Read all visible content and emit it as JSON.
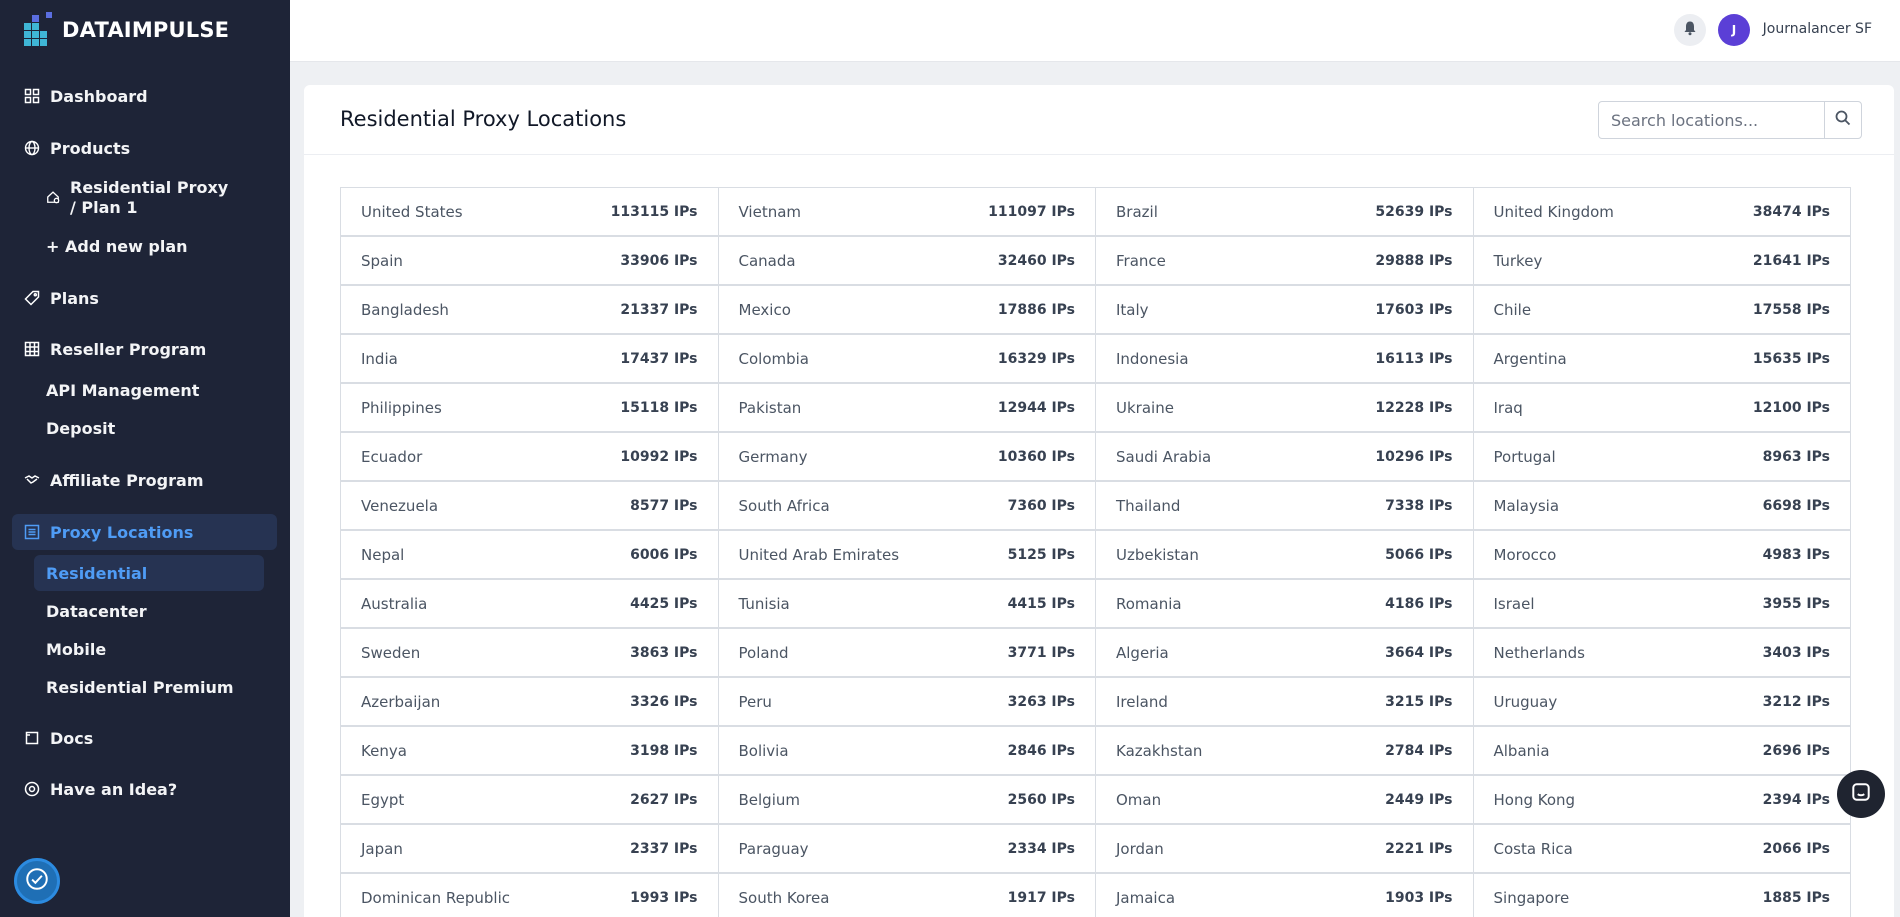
{
  "brand": {
    "name": "DATAIMPULSE",
    "mark_color": "#3fb6d6"
  },
  "sidebar": {
    "items": [
      {
        "label": "Dashboard",
        "icon": "dashboard-icon"
      },
      {
        "label": "Products",
        "icon": "globe-icon"
      },
      {
        "label": "Residential Proxy / Plan 1",
        "icon": "house-icon"
      },
      {
        "label": "+ Add new plan"
      },
      {
        "label": "Plans",
        "icon": "tag-icon"
      },
      {
        "label": "Reseller Program",
        "icon": "grid-icon"
      },
      {
        "label": "API Management"
      },
      {
        "label": "Deposit"
      },
      {
        "label": "Affiliate Program",
        "icon": "handshake-icon"
      },
      {
        "label": "Proxy Locations",
        "icon": "list-icon"
      },
      {
        "label": "Residential"
      },
      {
        "label": "Datacenter"
      },
      {
        "label": "Mobile"
      },
      {
        "label": "Residential Premium"
      },
      {
        "label": "Docs",
        "icon": "docs-icon"
      },
      {
        "label": "Have an Idea?",
        "icon": "idea-icon"
      }
    ]
  },
  "header": {
    "avatar_initial": "J",
    "username": "Journalancer SF"
  },
  "main": {
    "title": "Residential Proxy Locations",
    "search_placeholder": "Search locations...",
    "locations": [
      [
        "United States",
        "113115 IPs"
      ],
      [
        "Vietnam",
        "111097 IPs"
      ],
      [
        "Brazil",
        "52639 IPs"
      ],
      [
        "United Kingdom",
        "38474 IPs"
      ],
      [
        "Spain",
        "33906 IPs"
      ],
      [
        "Canada",
        "32460 IPs"
      ],
      [
        "France",
        "29888 IPs"
      ],
      [
        "Turkey",
        "21641 IPs"
      ],
      [
        "Bangladesh",
        "21337 IPs"
      ],
      [
        "Mexico",
        "17886 IPs"
      ],
      [
        "Italy",
        "17603 IPs"
      ],
      [
        "Chile",
        "17558 IPs"
      ],
      [
        "India",
        "17437 IPs"
      ],
      [
        "Colombia",
        "16329 IPs"
      ],
      [
        "Indonesia",
        "16113 IPs"
      ],
      [
        "Argentina",
        "15635 IPs"
      ],
      [
        "Philippines",
        "15118 IPs"
      ],
      [
        "Pakistan",
        "12944 IPs"
      ],
      [
        "Ukraine",
        "12228 IPs"
      ],
      [
        "Iraq",
        "12100 IPs"
      ],
      [
        "Ecuador",
        "10992 IPs"
      ],
      [
        "Germany",
        "10360 IPs"
      ],
      [
        "Saudi Arabia",
        "10296 IPs"
      ],
      [
        "Portugal",
        "8963 IPs"
      ],
      [
        "Venezuela",
        "8577 IPs"
      ],
      [
        "South Africa",
        "7360 IPs"
      ],
      [
        "Thailand",
        "7338 IPs"
      ],
      [
        "Malaysia",
        "6698 IPs"
      ],
      [
        "Nepal",
        "6006 IPs"
      ],
      [
        "United Arab Emirates",
        "5125 IPs"
      ],
      [
        "Uzbekistan",
        "5066 IPs"
      ],
      [
        "Morocco",
        "4983 IPs"
      ],
      [
        "Australia",
        "4425 IPs"
      ],
      [
        "Tunisia",
        "4415 IPs"
      ],
      [
        "Romania",
        "4186 IPs"
      ],
      [
        "Israel",
        "3955 IPs"
      ],
      [
        "Sweden",
        "3863 IPs"
      ],
      [
        "Poland",
        "3771 IPs"
      ],
      [
        "Algeria",
        "3664 IPs"
      ],
      [
        "Netherlands",
        "3403 IPs"
      ],
      [
        "Azerbaijan",
        "3326 IPs"
      ],
      [
        "Peru",
        "3263 IPs"
      ],
      [
        "Ireland",
        "3215 IPs"
      ],
      [
        "Uruguay",
        "3212 IPs"
      ],
      [
        "Kenya",
        "3198 IPs"
      ],
      [
        "Bolivia",
        "2846 IPs"
      ],
      [
        "Kazakhstan",
        "2784 IPs"
      ],
      [
        "Albania",
        "2696 IPs"
      ],
      [
        "Egypt",
        "2627 IPs"
      ],
      [
        "Belgium",
        "2560 IPs"
      ],
      [
        "Oman",
        "2449 IPs"
      ],
      [
        "Hong Kong",
        "2394 IPs"
      ],
      [
        "Japan",
        "2337 IPs"
      ],
      [
        "Paraguay",
        "2334 IPs"
      ],
      [
        "Jordan",
        "2221 IPs"
      ],
      [
        "Costa Rica",
        "2066 IPs"
      ],
      [
        "Dominican Republic",
        "1993 IPs"
      ],
      [
        "South Korea",
        "1917 IPs"
      ],
      [
        "Jamaica",
        "1903 IPs"
      ],
      [
        "Singapore",
        "1885 IPs"
      ]
    ]
  },
  "colors": {
    "sidebar_bg": "#1e2437",
    "active_text": "#4f9cf5",
    "active_bg": "#263352",
    "avatar_bg": "#5b3fd6"
  }
}
